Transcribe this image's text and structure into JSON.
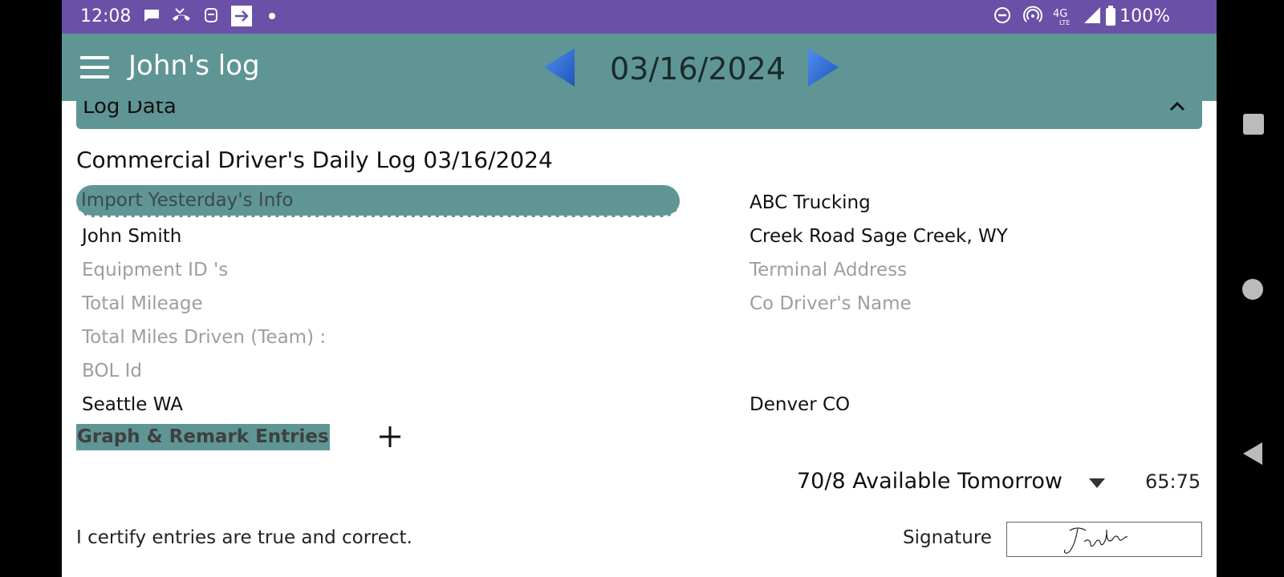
{
  "status_bar": {
    "time": "12:08",
    "battery": "100%",
    "icons": [
      "chat-bubble-icon",
      "phone-missed-icon",
      "app-notification-icon",
      "forward-arrow-icon",
      "dot-icon",
      "do-not-disturb-icon",
      "hotspot-icon",
      "lte-4g-icon",
      "signal-icon",
      "battery-icon"
    ]
  },
  "toolbar": {
    "title": "John's log",
    "date": "03/16/2024",
    "accent": "#609595",
    "arrow_color": "#2f6fd6"
  },
  "panel": {
    "header": "Log Data"
  },
  "log": {
    "doc_title": "Commercial Driver's Daily Log 03/16/2024",
    "import_button": "Import Yesterday's Info",
    "carrier": "ABC Trucking",
    "driver_name": "John Smith",
    "main_office": "Creek Road Sage Creek, WY",
    "equipment_placeholder": "Equipment ID 's",
    "terminal_placeholder": "Terminal Address",
    "mileage_placeholder": "Total Mileage",
    "co_driver_placeholder": "Co Driver's Name",
    "team_miles_placeholder": "Total Miles Driven (Team) :",
    "bol_placeholder": "BOL Id",
    "origin": "Seattle WA",
    "destination": "Denver CO"
  },
  "entries": {
    "label": "Graph & Remark Entries"
  },
  "availability": {
    "selected": "70/8 Available Tomorrow",
    "value": "65:75"
  },
  "certify": {
    "text": "I certify entries are true and correct.",
    "signature_label": "Signature"
  }
}
